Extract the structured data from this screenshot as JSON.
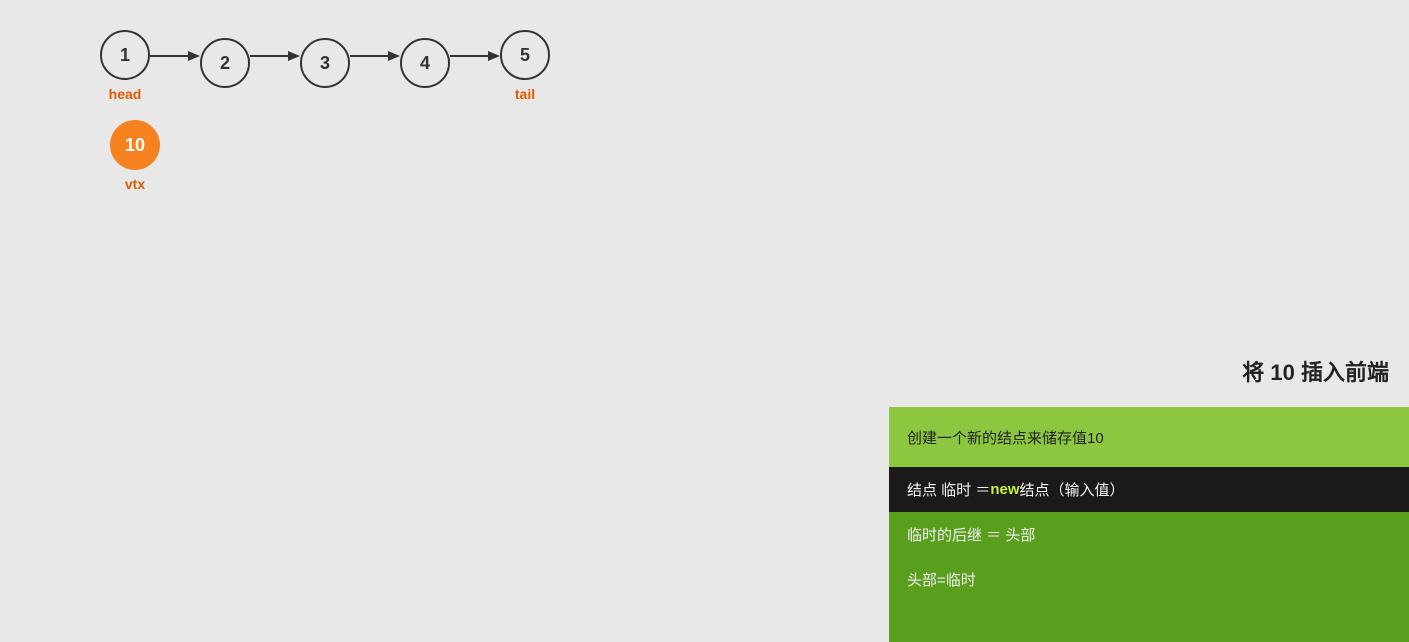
{
  "linkedList": {
    "nodes": [
      {
        "value": "1",
        "label": "head"
      },
      {
        "value": "2",
        "label": ""
      },
      {
        "value": "3",
        "label": ""
      },
      {
        "value": "4",
        "label": ""
      },
      {
        "value": "5",
        "label": "tail"
      }
    ]
  },
  "vtxNode": {
    "value": "10",
    "label": "vtx"
  },
  "panelTitle": "将 10 插入前端",
  "infoPanel": {
    "row1": "创建一个新的结点来储存值10",
    "row2_prefix": "结点  临时  ＝  ",
    "row2_keyword": "new",
    "row2_suffix": "  结点（输入值）",
    "row3": "临时的后继  ＝  头部",
    "row4": "头部=临时"
  }
}
